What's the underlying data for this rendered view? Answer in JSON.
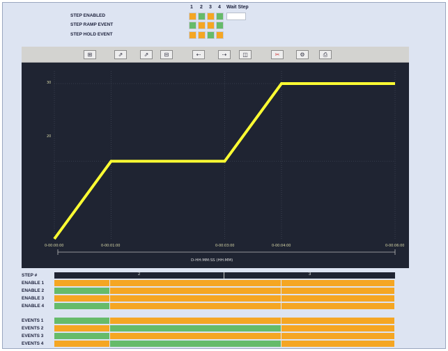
{
  "top_matrix": {
    "col_headers": [
      "1",
      "2",
      "3",
      "4",
      "Wait Step"
    ],
    "rows": [
      {
        "label": "STEP ENABLED",
        "cells": [
          "orange",
          "green",
          "orange",
          "green"
        ]
      },
      {
        "label": "STEP RAMP EVENT",
        "cells": [
          "green",
          "orange",
          "orange",
          "green"
        ]
      },
      {
        "label": "STEP HOLD EVENT",
        "cells": [
          "orange",
          "orange",
          "green",
          "orange"
        ]
      }
    ],
    "wait_value": ""
  },
  "toolbar": {
    "icons": [
      "zoom-box-icon",
      "zoom-y-icon",
      "zoom-x-icon",
      "fit-icon",
      "pan-left-icon",
      "pan-right-icon",
      "split-icon",
      "cut-icon",
      "settings-gear-icon",
      "print-icon"
    ]
  },
  "chart_data": {
    "type": "line",
    "xlabel": "D-HH:MM:SS (HH:MM)",
    "x_ticks": [
      "0-00:00:00",
      "0-00:01:00",
      "0-00:03:00",
      "0-00:04:00",
      "0-00:06:00"
    ],
    "y_ticks": [
      "30",
      "20"
    ],
    "ylim": [
      10,
      30
    ],
    "series": [
      {
        "color": "#ffff33",
        "x": [
          "0-00:00:00",
          "0-00:01:00",
          "0-00:03:00",
          "0-00:04:00",
          "0-00:06:00"
        ],
        "y": [
          10,
          20,
          20,
          30,
          30
        ]
      }
    ]
  },
  "step_grid": {
    "step_label": "STEP #",
    "steps": [
      "2",
      "3"
    ],
    "enable_rows": [
      {
        "label": "ENABLE 1",
        "segments": [
          "orange",
          "orange",
          "orange"
        ]
      },
      {
        "label": "ENABLE 2",
        "segments": [
          "green",
          "orange",
          "orange"
        ]
      },
      {
        "label": "ENABLE 3",
        "segments": [
          "orange",
          "orange",
          "orange"
        ]
      },
      {
        "label": "ENABLE 4",
        "segments": [
          "green",
          "orange",
          "orange"
        ]
      }
    ],
    "event_rows": [
      {
        "label": "EVENTS 1",
        "segments": [
          "green",
          "orange",
          "orange"
        ]
      },
      {
        "label": "EVENTS 2",
        "segments": [
          "orange",
          "green",
          "orange"
        ]
      },
      {
        "label": "EVENTS 3",
        "segments": [
          "green",
          "orange",
          "orange"
        ]
      },
      {
        "label": "EVENTS 4",
        "segments": [
          "orange",
          "green",
          "orange"
        ]
      }
    ]
  },
  "colors": {
    "orange": "#f5a623",
    "green": "#66bb6a",
    "line": "#ffff33",
    "chart_bg": "#1f2432"
  }
}
